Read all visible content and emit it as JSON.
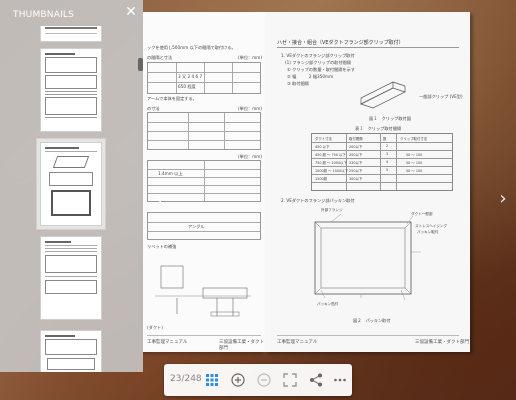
{
  "panel": {
    "title": "THUMBNAILS",
    "close_icon": "close-icon"
  },
  "thumbnails": [
    {
      "label": "page-21"
    },
    {
      "label": "page-22"
    },
    {
      "label": "page-23",
      "selected": true
    },
    {
      "label": "page-24"
    },
    {
      "label": "page-25"
    }
  ],
  "left_page": {
    "lines": [
      "ックを使用し500mm 以下の間隔で取付ける。",
      "の間隔と寸法",
      "(単位：mm)",
      "3 又 2 4 6 7",
      "650 程度",
      "アームで本体を固定する。",
      "(単位：mm)",
      "の寸法",
      "(単位：mm)",
      "1.4mm 以上",
      "アングル",
      "リベットの補強",
      "(ダクト)",
      "工事監理マニュアル",
      "三協設備工業・ダクト部門"
    ]
  },
  "right_page": {
    "title": "ハゼ・接合・組合（VEダクトフランジ部クリップ取付）",
    "lines": [
      "1. VEダクトのフランジ部クリップ取付",
      "(1) フランジ部クリップの取付間隔",
      "① クリップの数量・取付間隔を示す",
      "② 幅　　　2  幅350mm",
      "③ 取付間隔",
      "一般部クリップ (VE型)",
      "図１　クリップ取付図",
      "表１　クリップ取付間隔",
      "2. VEダクトのフランジ部パッキン取付",
      "外部フランジ",
      "ダクト一般部",
      "ストレスヘイジング",
      "パッキン取付",
      "パッキン貼付",
      "図２　パッキン取付",
      "工事監理マニュアル",
      "三協設備工業・ダクト部門"
    ],
    "table": {
      "headers": [
        "ダクト寸法",
        "取付間隔",
        "数",
        "クリップ取付寸法"
      ],
      "rows": [
        [
          "450 以下",
          "200以下",
          "2",
          ""
        ],
        [
          "450 超 ～ 750 以下",
          "200以下",
          "3",
          "50 ～ 100"
        ],
        [
          "750 超 ～ 1000以下",
          "230以下",
          "4",
          "50 ～ 100"
        ],
        [
          "1000超 ～ 1500以下",
          "250以下",
          "5",
          "50 ～ 100"
        ],
        [
          "1500超",
          "300以下",
          "",
          ""
        ]
      ]
    }
  },
  "toolbar": {
    "page_indicator": "23/248",
    "buttons": [
      {
        "name": "thumbnails-grid-button",
        "icon": "grid-icon",
        "active": true
      },
      {
        "name": "zoom-in-button",
        "icon": "zoom-in-icon"
      },
      {
        "name": "zoom-out-button",
        "icon": "zoom-out-icon"
      },
      {
        "name": "fullscreen-button",
        "icon": "fullscreen-icon"
      },
      {
        "name": "share-button",
        "icon": "share-icon"
      },
      {
        "name": "more-button",
        "icon": "more-icon"
      }
    ]
  },
  "colors": {
    "accent": "#2d8fd9",
    "panel": "#c8c8c8"
  }
}
